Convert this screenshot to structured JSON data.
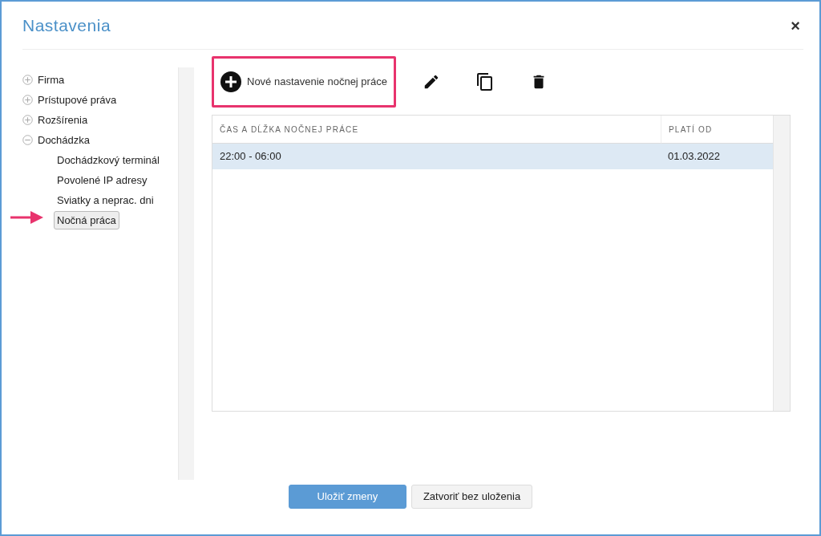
{
  "dialog": {
    "title": "Nastavenia",
    "close": "×"
  },
  "sidebar": {
    "items": [
      {
        "label": "Firma",
        "expanded": false,
        "selected": false
      },
      {
        "label": "Prístupové práva",
        "expanded": false,
        "selected": false
      },
      {
        "label": "Rozšírenia",
        "expanded": false,
        "selected": false
      },
      {
        "label": "Dochádzka",
        "expanded": true,
        "selected": false,
        "children": [
          {
            "label": "Dochádzkový terminál",
            "selected": false
          },
          {
            "label": "Povolené IP adresy",
            "selected": false
          },
          {
            "label": "Sviatky a neprac. dni",
            "selected": false
          },
          {
            "label": "Nočná práca",
            "selected": true
          }
        ]
      }
    ]
  },
  "toolbar": {
    "buttons": [
      {
        "kind": "add",
        "label": "Nové nastavenie nočnej práce",
        "highlighted": true
      },
      {
        "kind": "edit",
        "highlighted": false
      },
      {
        "kind": "copy",
        "highlighted": false
      },
      {
        "kind": "delete",
        "highlighted": false
      }
    ]
  },
  "table": {
    "columns": [
      "ČAS A DĹŽKA NOČNEJ PRÁCE",
      "PLATÍ OD"
    ],
    "rows": [
      {
        "cells": [
          "22:00 - 06:00",
          "01.03.2022"
        ],
        "selected": true
      }
    ]
  },
  "footer": {
    "buttons": [
      {
        "label": "Uložiť zmeny",
        "kind": "primary"
      },
      {
        "label": "Zatvoriť bez uloženia",
        "kind": "secondary"
      }
    ]
  }
}
